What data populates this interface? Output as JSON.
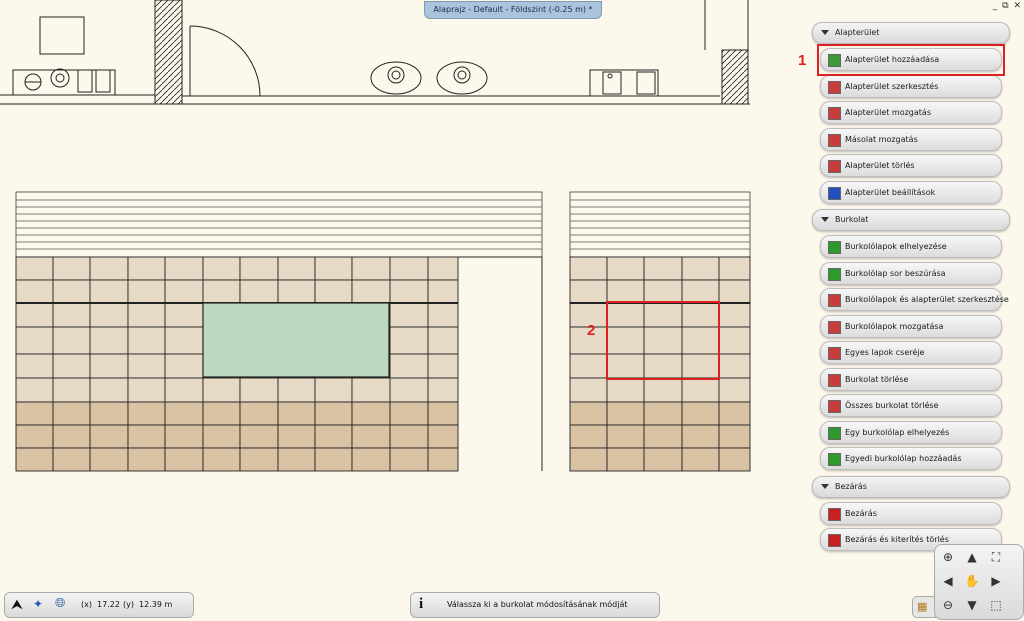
{
  "window": {
    "title": "Alaprajz - Default - Földszint (-0.25 m) *",
    "controls": "_ ⧉ ✕"
  },
  "panel": {
    "sections": [
      {
        "label": "Alapterület",
        "buttons": [
          {
            "label": "Alapterület hozzáadása",
            "icon": "add-floor-icon"
          },
          {
            "label": "Alapterület szerkesztés",
            "icon": "edit-floor-icon"
          },
          {
            "label": "Alapterület mozgatás",
            "icon": "move-floor-icon"
          },
          {
            "label": "Másolat mozgatás",
            "icon": "copy-move-icon"
          },
          {
            "label": "Alapterület törlés",
            "icon": "delete-floor-icon"
          },
          {
            "label": "Alapterület beállítások",
            "icon": "floor-settings-icon"
          }
        ]
      },
      {
        "label": "Burkolat",
        "buttons": [
          {
            "label": "Burkolólapok elhelyezése",
            "icon": "place-tiles-icon"
          },
          {
            "label": "Burkolólap sor beszúrása",
            "icon": "insert-tile-row-icon"
          },
          {
            "label": "Burkolólapok és alapterület szerkesztése",
            "icon": "edit-tiles-floor-icon"
          },
          {
            "label": "Burkolólapok mozgatása",
            "icon": "move-tiles-icon"
          },
          {
            "label": "Egyes lapok cseréje",
            "icon": "replace-tile-icon"
          },
          {
            "label": "Burkolat törlése",
            "icon": "delete-covering-icon"
          },
          {
            "label": "Összes burkolat törlése",
            "icon": "delete-all-coverings-icon"
          },
          {
            "label": "Egy burkolólap elhelyezés",
            "icon": "place-single-tile-icon"
          },
          {
            "label": "Egyedi burkolólap hozzáadás",
            "icon": "add-custom-tile-icon"
          }
        ]
      },
      {
        "label": "Bezárás",
        "buttons": [
          {
            "label": "Bezárás",
            "icon": "close-icon"
          },
          {
            "label": "Bezárás és kiterítés törlés",
            "icon": "close-clear-icon"
          }
        ]
      }
    ]
  },
  "annotations": {
    "marker1": "1",
    "marker2": "2"
  },
  "status": {
    "x_label": "(x)",
    "x_value": "17.22",
    "y_label": "(y)",
    "y_value": "12.39 m"
  },
  "hint": {
    "text": "Válassza ki a burkolat módosításának módját"
  },
  "colors": {
    "tile_light": "#e6dac7",
    "tile_dark": "#d9c3a4",
    "selected_area": "#bcd8bf",
    "highlight": "#e02020",
    "background": "#fdf8ec"
  }
}
